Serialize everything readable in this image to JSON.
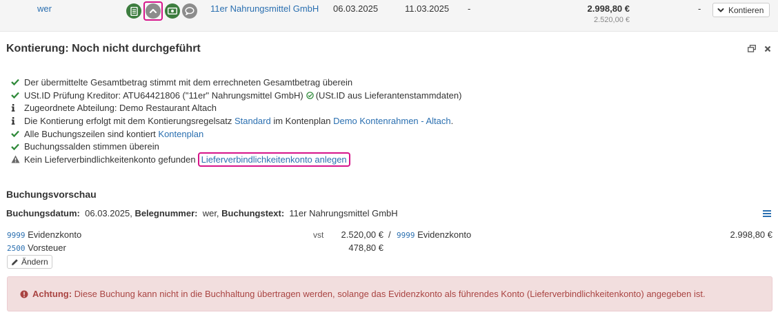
{
  "top_row": {
    "beleg": "wer",
    "vendor": "11er Nahrungsmittel GmbH",
    "date1": "06.03.2025",
    "date2": "11.03.2025",
    "dash1": "-",
    "amount_gross": "2.998,80 €",
    "amount_net": "2.520,00 €",
    "dash2": "-",
    "kontieren_label": "Kontieren",
    "icons": [
      "document-icon",
      "chevron-up-icon",
      "money-icon",
      "comment-icon"
    ]
  },
  "panel": {
    "title": "Kontierung: Noch nicht durchgeführt"
  },
  "checks": [
    {
      "icon": "check-icon",
      "text": "Der übermittelte Gesamtbetrag stimmt mit dem errechneten Gesamtbetrag überein"
    },
    {
      "icon": "check-icon",
      "text_before": "USt.ID Prüfung Kreditor: ATU64421806 (\"11er\" Nahrungsmittel GmbH)",
      "text_after": "(USt.ID aus Lieferantenstammdaten)"
    },
    {
      "icon": "info-icon",
      "text": "Zugeordnete Abteilung: Demo Restaurant Altach"
    },
    {
      "icon": "info-icon",
      "text_before": "Die Kontierung erfolgt mit dem Kontierungsregelsatz",
      "link1": "Standard",
      "text_mid": "im Kontenplan",
      "link2": "Demo Kontenrahmen - Altach",
      "text_after": "."
    },
    {
      "icon": "check-icon",
      "text_before": "Alle Buchungszeilen sind kontiert",
      "link": "Kontenplan"
    },
    {
      "icon": "check-icon",
      "text": "Buchungssalden stimmen überein"
    },
    {
      "icon": "warning-icon",
      "text_before": "Kein Lieferverbindlichkeitenkonto gefunden",
      "link": "Lieferverbindlichkeitenkonto anlegen"
    }
  ],
  "preview": {
    "title": "Buchungsvorschau",
    "datum_label": "Buchungsdatum:",
    "datum": "06.03.2025,",
    "beleg_label": "Belegnummer:",
    "beleg": "wer,",
    "text_label": "Buchungstext:",
    "text": "11er Nahrungsmittel GmbH",
    "rows": [
      {
        "account": "9999",
        "name": "Evidenzkonto",
        "tax": "vst",
        "amount": "2.520,00 €",
        "sep": "/",
        "contra_account": "9999",
        "contra_name": "Evidenzkonto",
        "contra_amount": "2.998,80 €"
      },
      {
        "account": "2500",
        "name": "Vorsteuer",
        "amount": "478,80 €"
      }
    ],
    "aendern_label": "Ändern"
  },
  "alert": {
    "label": "Achtung:",
    "text": "Diese Buchung kann nicht in die Buchhaltung übertragen werden, solange das Evidenzkonto als führendes Konto (Lieferverbindlichkeitenkonto) angegeben ist."
  },
  "colors": {
    "green": "#3d7d3f",
    "link": "#2a6fb0",
    "highlight": "#d6138a",
    "alert_bg": "#f2dede",
    "alert_text": "#a94442"
  }
}
